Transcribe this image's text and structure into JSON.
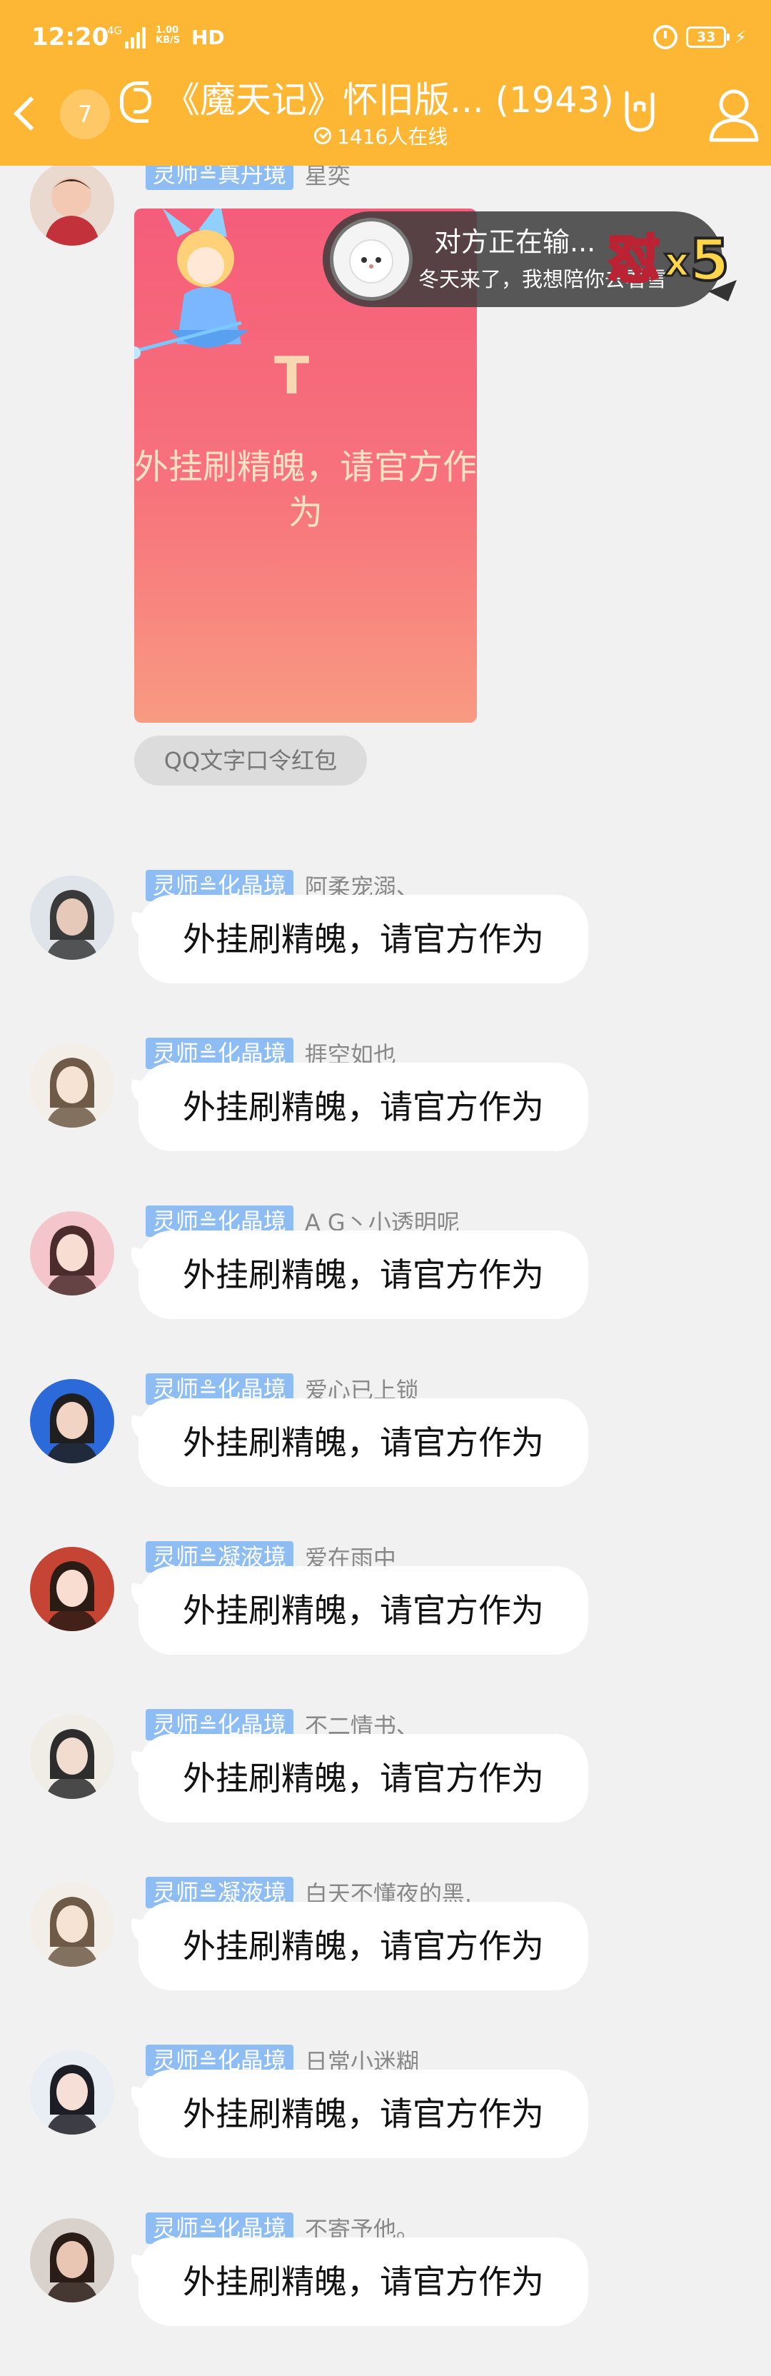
{
  "status_bar": {
    "time": "12:20",
    "network": "4G",
    "speed_value": "1.00",
    "speed_unit": "KB/S",
    "hd": "HD",
    "battery": "33"
  },
  "header": {
    "unread_count": "7",
    "title": "《魔天记》怀旧版... (1943)",
    "online": "1416人在线"
  },
  "red_packet": {
    "sender_rank": "灵师≗真丹境",
    "sender_name": "星奕",
    "message": "外挂刷精魄，请官方作为",
    "tag": "QQ文字口令红包",
    "logo_letter": "T"
  },
  "notification": {
    "line1": "对方正在输...",
    "line2": "冬天来了，我想陪你去看雪",
    "combo": "怼x5"
  },
  "messages": [
    {
      "rank": "灵师≗化晶境",
      "name": "阿柔宠溺、",
      "text": "外挂刷精魄，请官方作为"
    },
    {
      "rank": "灵师≗化晶境",
      "name": "捱空如也",
      "text": "外挂刷精魄，请官方作为"
    },
    {
      "rank": "灵师≗化晶境",
      "name": "A G丶小透明呢",
      "text": "外挂刷精魄，请官方作为"
    },
    {
      "rank": "灵师≗化晶境",
      "name": "爱心已上锁",
      "text": "外挂刷精魄，请官方作为"
    },
    {
      "rank": "灵师≗凝液境",
      "name": "爱在雨中",
      "text": "外挂刷精魄，请官方作为"
    },
    {
      "rank": "灵师≗化晶境",
      "name": "不二情书、",
      "text": "外挂刷精魄，请官方作为"
    },
    {
      "rank": "灵师≗凝液境",
      "name": "白天不懂夜的黑.",
      "text": "外挂刷精魄，请官方作为"
    },
    {
      "rank": "灵师≗化晶境",
      "name": "日常小迷糊",
      "text": "外挂刷精魄，请官方作为"
    },
    {
      "rank": "灵师≗化晶境",
      "name": "不寄予他。",
      "text": "外挂刷精魄，请官方作为"
    }
  ],
  "colors": {
    "header_bg": "#fdb735",
    "rank_badge": "#8dbdf3",
    "chat_bg": "#f1f1f1",
    "packet_red": "#f55d7a"
  }
}
